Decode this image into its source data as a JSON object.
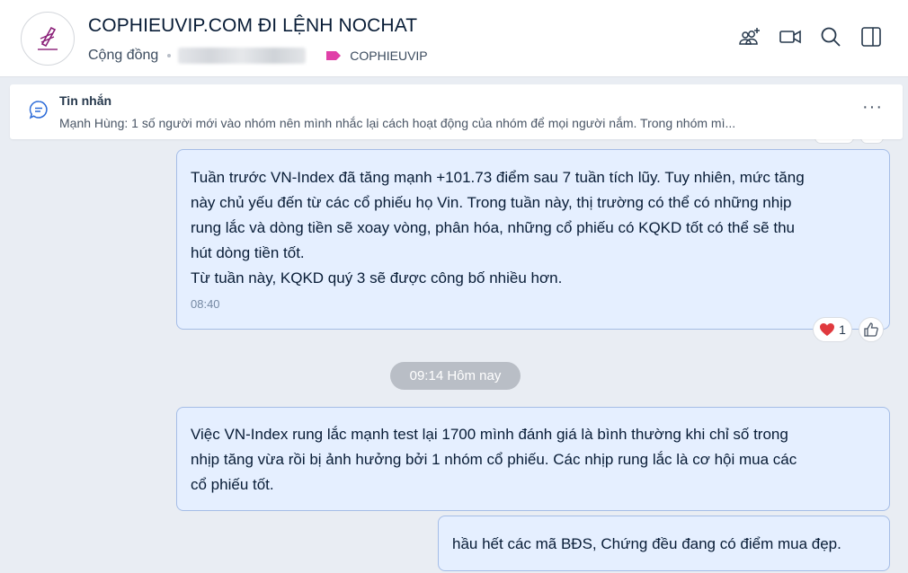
{
  "header": {
    "title": "COPHIEUVIP.COM ĐI LỆNH NOCHAT",
    "type_label": "Cộng đồng",
    "tag_label": "COPHIEUVIP",
    "tag_color": "#e040a8",
    "icons": [
      "add-member-icon",
      "video-call-icon",
      "search-icon",
      "toggle-panel-icon"
    ]
  },
  "pinned": {
    "title": "Tin nhắn",
    "text": "Mạnh Hùng: 1 số người mới vào nhóm nên mình nhắc lại cách hoạt động của nhóm để mọi người nắm. Trong nhóm mì..."
  },
  "messages": [
    {
      "lines": [
        "Tuần trước VN-Index đã tăng mạnh +101.73 điểm sau 7 tuần tích lũy. Tuy nhiên, mức tăng",
        "này chủ yếu đến từ các cổ phiếu họ Vin. Trong tuần này, thị trường có thể có những nhịp",
        "rung lắc và dòng tiền sẽ xoay vòng, phân hóa, những cổ phiếu có KQKD tốt có thể sẽ thu",
        "hút dòng tiền tốt.",
        "Từ tuần này, KQKD quý 3 sẽ được công bố nhiều hơn."
      ],
      "time": "08:40",
      "reaction_count": "1"
    },
    {
      "lines": [
        "Việc VN-Index rung lắc mạnh test lại 1700 mình đánh giá là bình thường khi chỉ số trong",
        "nhịp tăng vừa rồi bị ảnh hưởng bởi 1 nhóm cổ phiếu. Các nhịp rung lắc là cơ hội mua các",
        "cổ phiếu tốt."
      ]
    },
    {
      "lines": [
        "hầu hết các mã BĐS, Chứng đều đang có điểm mua đẹp."
      ]
    }
  ],
  "date_separator": "09:14 Hôm nay",
  "colors": {
    "bubble_bg": "#e5efff",
    "bubble_border": "#a5bde6",
    "background": "#e9edf3"
  }
}
